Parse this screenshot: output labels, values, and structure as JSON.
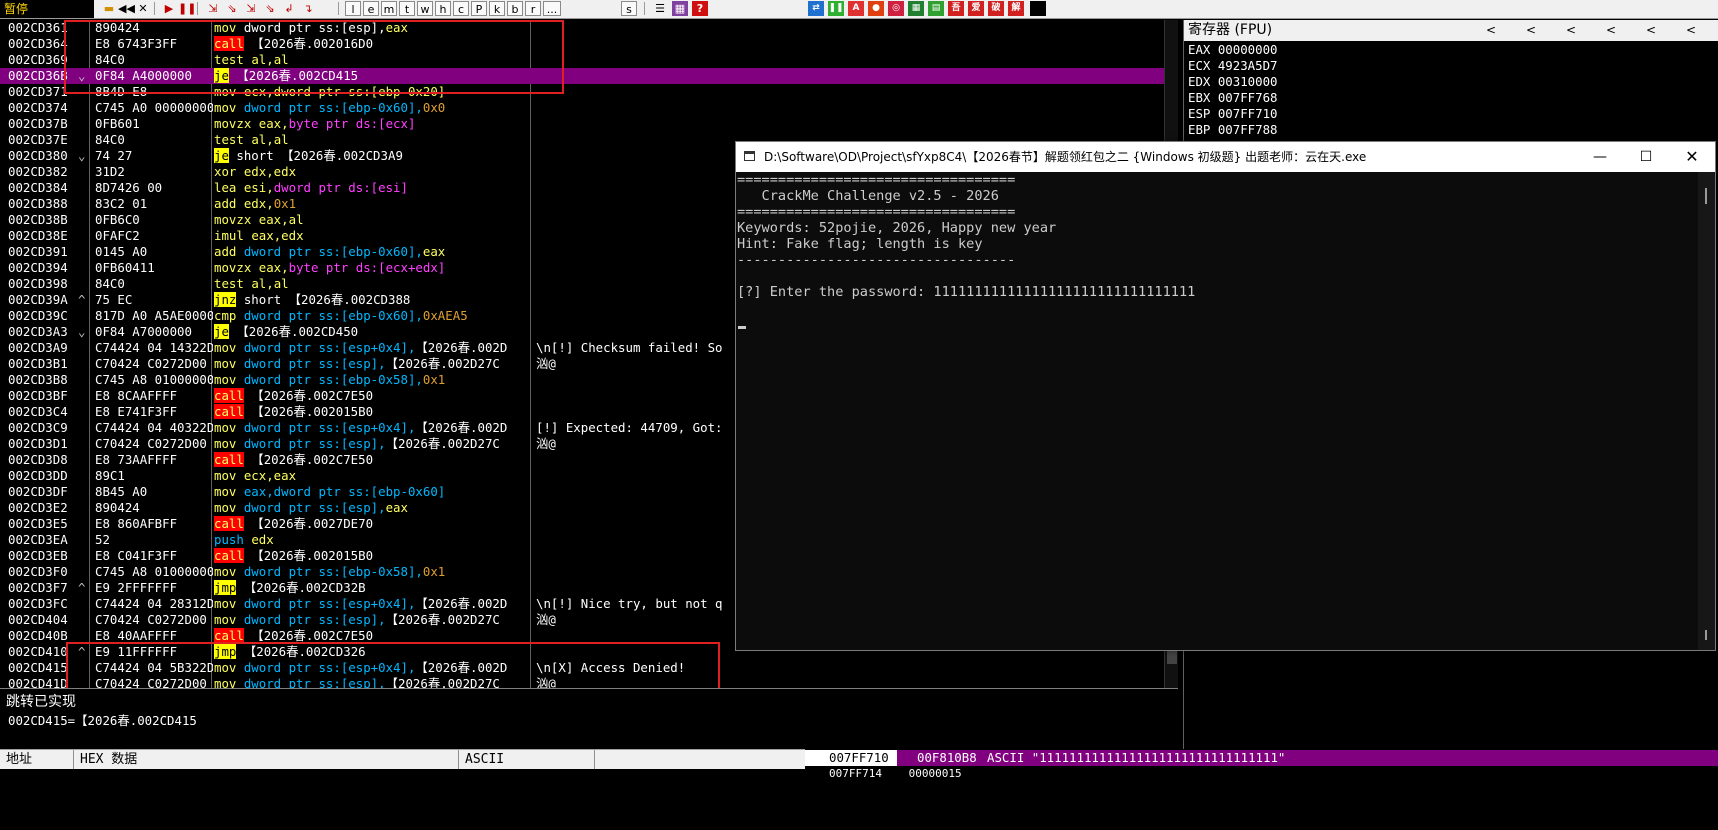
{
  "toolbar": {
    "status": "暂停",
    "letters": [
      "l",
      "e",
      "m",
      "t",
      "w",
      "h",
      "c",
      "P",
      "k",
      "b",
      "r",
      "...",
      "s"
    ],
    "cn_buttons": [
      "吾",
      "爱",
      "破",
      "解"
    ],
    "colors": {
      "accent_red": "#c00000",
      "status_bg": "#000000",
      "status_fg": "#ffd800"
    }
  },
  "disasm": {
    "rows": [
      {
        "addr": "002CD361",
        "mark": "",
        "hex": "890424",
        "asm": [
          [
            "mov ",
            "y"
          ],
          [
            "dword ptr ss:[esp],",
            "w"
          ],
          [
            "eax",
            "y"
          ]
        ],
        "cmt": ""
      },
      {
        "addr": "002CD364",
        "mark": "",
        "hex": "E8 6743F3FF",
        "asm": [
          [
            "call",
            "call"
          ],
          [
            " 【2026春.002016D0",
            "w"
          ]
        ],
        "cmt": ""
      },
      {
        "addr": "002CD369",
        "mark": "",
        "hex": "84C0",
        "asm": [
          [
            "test ",
            "y"
          ],
          [
            "al,al",
            "y"
          ]
        ],
        "cmt": ""
      },
      {
        "addr": "002CD36B",
        "mark": "⌄",
        "hex": "0F84 A4000000",
        "asm": [
          [
            "je",
            "jmp"
          ],
          [
            " 【2026春.002CD415",
            "w"
          ]
        ],
        "cmt": "",
        "sel": true
      },
      {
        "addr": "002CD371",
        "mark": "",
        "hex": "8B4D E8",
        "asm": [
          [
            "mov ",
            "y"
          ],
          [
            "ecx,dword ptr ss:[ebp-0x20]",
            "y"
          ]
        ],
        "cmt": ""
      },
      {
        "addr": "002CD374",
        "mark": "",
        "hex": "C745 A0 00000000",
        "asm": [
          [
            "mov ",
            "y"
          ],
          [
            "dword ptr ss:[ebp-0x60],",
            "cy"
          ],
          [
            "0x0",
            "o"
          ]
        ],
        "cmt": ""
      },
      {
        "addr": "002CD37B",
        "mark": "",
        "hex": "0FB601",
        "asm": [
          [
            "movzx ",
            "y"
          ],
          [
            "eax,",
            "y"
          ],
          [
            "byte ptr ds:[ecx]",
            "m"
          ]
        ],
        "cmt": ""
      },
      {
        "addr": "002CD37E",
        "mark": "",
        "hex": "84C0",
        "asm": [
          [
            "test ",
            "y"
          ],
          [
            "al,al",
            "y"
          ]
        ],
        "cmt": ""
      },
      {
        "addr": "002CD380",
        "mark": "⌄",
        "hex": "74 27",
        "asm": [
          [
            "je",
            "jmp"
          ],
          [
            " short 【2026春.002CD3A9",
            "w"
          ]
        ],
        "cmt": ""
      },
      {
        "addr": "002CD382",
        "mark": "",
        "hex": "31D2",
        "asm": [
          [
            "xor ",
            "y"
          ],
          [
            "edx,edx",
            "y"
          ]
        ],
        "cmt": ""
      },
      {
        "addr": "002CD384",
        "mark": "",
        "hex": "8D7426 00",
        "asm": [
          [
            "lea ",
            "y"
          ],
          [
            "esi,",
            "y"
          ],
          [
            "dword ptr ds:[esi]",
            "m"
          ]
        ],
        "cmt": ""
      },
      {
        "addr": "002CD388",
        "mark": "",
        "hex": "83C2 01",
        "asm": [
          [
            "add ",
            "y"
          ],
          [
            "edx,",
            "y"
          ],
          [
            "0x1",
            "o"
          ]
        ],
        "cmt": ""
      },
      {
        "addr": "002CD38B",
        "mark": "",
        "hex": "0FB6C0",
        "asm": [
          [
            "movzx ",
            "y"
          ],
          [
            "eax,al",
            "y"
          ]
        ],
        "cmt": ""
      },
      {
        "addr": "002CD38E",
        "mark": "",
        "hex": "0FAFC2",
        "asm": [
          [
            "imul ",
            "y"
          ],
          [
            "eax,edx",
            "y"
          ]
        ],
        "cmt": ""
      },
      {
        "addr": "002CD391",
        "mark": "",
        "hex": "0145 A0",
        "asm": [
          [
            "add ",
            "y"
          ],
          [
            "dword ptr ss:[ebp-0x60],",
            "cy"
          ],
          [
            "eax",
            "y"
          ]
        ],
        "cmt": ""
      },
      {
        "addr": "002CD394",
        "mark": "",
        "hex": "0FB60411",
        "asm": [
          [
            "movzx ",
            "y"
          ],
          [
            "eax,",
            "y"
          ],
          [
            "byte ptr ds:[ecx+edx]",
            "m"
          ]
        ],
        "cmt": ""
      },
      {
        "addr": "002CD398",
        "mark": "",
        "hex": "84C0",
        "asm": [
          [
            "test ",
            "y"
          ],
          [
            "al,al",
            "y"
          ]
        ],
        "cmt": ""
      },
      {
        "addr": "002CD39A",
        "mark": "^",
        "hex": "75 EC",
        "asm": [
          [
            "jnz",
            "jmp"
          ],
          [
            " short 【2026春.002CD388",
            "w"
          ]
        ],
        "cmt": ""
      },
      {
        "addr": "002CD39C",
        "mark": "",
        "hex": "817D A0 A5AE0000",
        "asm": [
          [
            "cmp ",
            "y"
          ],
          [
            "dword ptr ss:[ebp-0x60],",
            "cy"
          ],
          [
            "0xAEA5",
            "o"
          ]
        ],
        "cmt": ""
      },
      {
        "addr": "002CD3A3",
        "mark": "⌄",
        "hex": "0F84 A7000000",
        "asm": [
          [
            "je",
            "jmp"
          ],
          [
            " 【2026春.002CD450",
            "w"
          ]
        ],
        "cmt": ""
      },
      {
        "addr": "002CD3A9",
        "mark": "",
        "hex": "C74424 04 14322D00",
        "asm": [
          [
            "mov ",
            "y"
          ],
          [
            "dword ptr ss:[esp+0x4],",
            "cy"
          ],
          [
            "【2026春.002D",
            "w"
          ]
        ],
        "cmt": "\\n[!] Checksum failed! So"
      },
      {
        "addr": "002CD3B1",
        "mark": "",
        "hex": "C70424 C0272D00",
        "asm": [
          [
            "mov ",
            "y"
          ],
          [
            "dword ptr ss:[esp],",
            "cy"
          ],
          [
            "【2026春.002D27C",
            "w"
          ]
        ],
        "cmt": "汹@"
      },
      {
        "addr": "002CD3B8",
        "mark": "",
        "hex": "C745 A8 01000000",
        "asm": [
          [
            "mov ",
            "y"
          ],
          [
            "dword ptr ss:[ebp-0x58],",
            "cy"
          ],
          [
            "0x1",
            "o"
          ]
        ],
        "cmt": ""
      },
      {
        "addr": "002CD3BF",
        "mark": "",
        "hex": "E8 8CAAFFFF",
        "asm": [
          [
            "call",
            "call"
          ],
          [
            " 【2026春.002C7E50",
            "w"
          ]
        ],
        "cmt": ""
      },
      {
        "addr": "002CD3C4",
        "mark": "",
        "hex": "E8 E741F3FF",
        "asm": [
          [
            "call",
            "call"
          ],
          [
            " 【2026春.002015B0",
            "w"
          ]
        ],
        "cmt": ""
      },
      {
        "addr": "002CD3C9",
        "mark": "",
        "hex": "C74424 04 40322D00",
        "asm": [
          [
            "mov ",
            "y"
          ],
          [
            "dword ptr ss:[esp+0x4],",
            "cy"
          ],
          [
            "【2026春.002D",
            "w"
          ]
        ],
        "cmt": "[!] Expected: 44709, Got:"
      },
      {
        "addr": "002CD3D1",
        "mark": "",
        "hex": "C70424 C0272D00",
        "asm": [
          [
            "mov ",
            "y"
          ],
          [
            "dword ptr ss:[esp],",
            "cy"
          ],
          [
            "【2026春.002D27C",
            "w"
          ]
        ],
        "cmt": "汹@"
      },
      {
        "addr": "002CD3D8",
        "mark": "",
        "hex": "E8 73AAFFFF",
        "asm": [
          [
            "call",
            "call"
          ],
          [
            " 【2026春.002C7E50",
            "w"
          ]
        ],
        "cmt": ""
      },
      {
        "addr": "002CD3DD",
        "mark": "",
        "hex": "89C1",
        "asm": [
          [
            "mov ",
            "y"
          ],
          [
            "ecx,eax",
            "y"
          ]
        ],
        "cmt": ""
      },
      {
        "addr": "002CD3DF",
        "mark": "",
        "hex": "8B45 A0",
        "asm": [
          [
            "mov ",
            "y"
          ],
          [
            "eax,dword ptr ss:[ebp-0x60]",
            "cy"
          ]
        ],
        "cmt": ""
      },
      {
        "addr": "002CD3E2",
        "mark": "",
        "hex": "890424",
        "asm": [
          [
            "mov ",
            "y"
          ],
          [
            "dword ptr ss:[esp],",
            "cy"
          ],
          [
            "eax",
            "y"
          ]
        ],
        "cmt": ""
      },
      {
        "addr": "002CD3E5",
        "mark": "",
        "hex": "E8 860AFBFF",
        "asm": [
          [
            "call",
            "call"
          ],
          [
            " 【2026春.0027DE70",
            "w"
          ]
        ],
        "cmt": ""
      },
      {
        "addr": "002CD3EA",
        "mark": "",
        "hex": "52",
        "asm": [
          [
            "push ",
            "cy"
          ],
          [
            "edx",
            "y"
          ]
        ],
        "cmt": ""
      },
      {
        "addr": "002CD3EB",
        "mark": "",
        "hex": "E8 C041F3FF",
        "asm": [
          [
            "call",
            "call"
          ],
          [
            " 【2026春.002015B0",
            "w"
          ]
        ],
        "cmt": ""
      },
      {
        "addr": "002CD3F0",
        "mark": "",
        "hex": "C745 A8 01000000",
        "asm": [
          [
            "mov ",
            "y"
          ],
          [
            "dword ptr ss:[ebp-0x58],",
            "cy"
          ],
          [
            "0x1",
            "o"
          ]
        ],
        "cmt": ""
      },
      {
        "addr": "002CD3F7",
        "mark": "^",
        "hex": "E9 2FFFFFFF",
        "asm": [
          [
            "jmp",
            "jmp"
          ],
          [
            " 【2026春.002CD32B",
            "w"
          ]
        ],
        "cmt": ""
      },
      {
        "addr": "002CD3FC",
        "mark": "",
        "hex": "C74424 04 28312D00",
        "asm": [
          [
            "mov ",
            "y"
          ],
          [
            "dword ptr ss:[esp+0x4],",
            "cy"
          ],
          [
            "【2026春.002D",
            "w"
          ]
        ],
        "cmt": "\\n[!] Nice try, but not q"
      },
      {
        "addr": "002CD404",
        "mark": "",
        "hex": "C70424 C0272D00",
        "asm": [
          [
            "mov ",
            "y"
          ],
          [
            "dword ptr ss:[esp],",
            "cy"
          ],
          [
            "【2026春.002D27C",
            "w"
          ]
        ],
        "cmt": "汹@"
      },
      {
        "addr": "002CD40B",
        "mark": "",
        "hex": "E8 40AAFFFF",
        "asm": [
          [
            "call",
            "call"
          ],
          [
            " 【2026春.002C7E50",
            "w"
          ]
        ],
        "cmt": ""
      },
      {
        "addr": "002CD410",
        "mark": "^",
        "hex": "E9 11FFFFFF",
        "asm": [
          [
            "jmp",
            "jmp"
          ],
          [
            " 【2026春.002CD326",
            "w"
          ]
        ],
        "cmt": ""
      },
      {
        "addr": "002CD415",
        "mark": "",
        "hex": "C74424 04 5B322D00",
        "asm": [
          [
            "mov ",
            "y"
          ],
          [
            "dword ptr ss:[esp+0x4],",
            "cy"
          ],
          [
            "【2026春.002D",
            "w"
          ]
        ],
        "cmt": "\\n[X] Access Denied!"
      },
      {
        "addr": "002CD41D",
        "mark": "",
        "hex": "C70424 C0272D00",
        "asm": [
          [
            "mov ",
            "y"
          ],
          [
            "dword ptr ss:[esp],",
            "cy"
          ],
          [
            "【2026春.002D27C",
            "w"
          ]
        ],
        "cmt": "汹@"
      }
    ]
  },
  "info": {
    "line1": "跳转已实现",
    "line2": "002CD415=【2026春.002CD415"
  },
  "dump": {
    "col_addr": "地址",
    "col_hex": "HEX 数据",
    "col_ascii": "ASCII"
  },
  "stack": {
    "addr": "007FF710",
    "val": "00F810B8",
    "cmt": "ASCII \"11111111111111111111111111111111\"",
    "next_addr": "007FF714",
    "next_val": "00000015"
  },
  "registers": {
    "header": "寄存器 (FPU)",
    "rows": [
      "EAX 00000000",
      "ECX 4923A5D7",
      "EDX 00310000",
      "EBX 007FF768",
      "ESP 007FF710",
      "EBP 007FF788"
    ]
  },
  "console": {
    "title": "D:\\Software\\OD\\Project\\sfYxp8C4\\【2026春节】解题领红包之二 {Windows 初级题} 出题老师：云在天.exe",
    "lines": [
      "==================================",
      "   CrackMe Challenge v2.5 - 2026",
      "==================================",
      "Keywords: 52pojie, 2026, Happy new year",
      "Hint: Fake flag; length is key",
      "----------------------------------",
      "",
      "[?] Enter the password: 11111111111111111111111111111111"
    ]
  }
}
